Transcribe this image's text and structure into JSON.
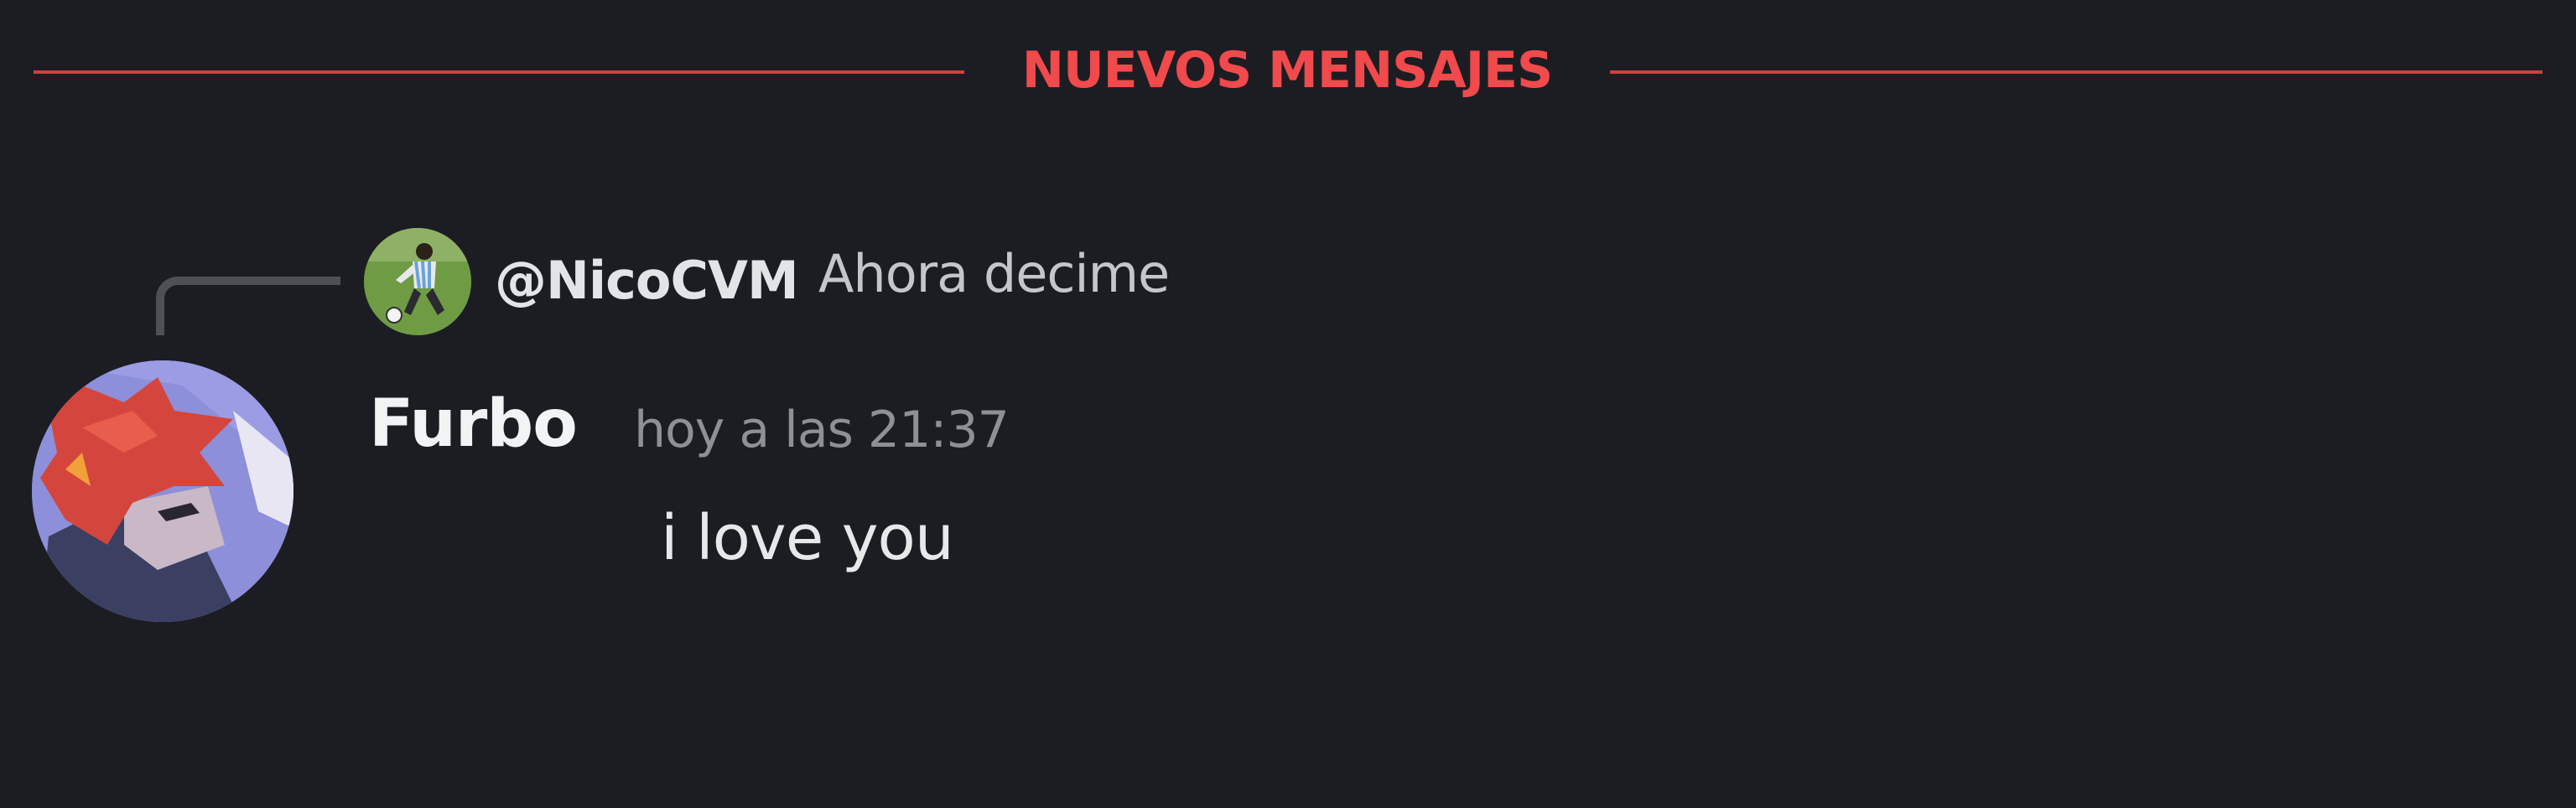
{
  "divider": {
    "label": "NUEVOS MENSAJES"
  },
  "reply": {
    "author": "@NicoCVM",
    "text": "Ahora decime",
    "avatar_icon": "soccer-player-avatar-icon"
  },
  "message": {
    "author": "Furbo",
    "timestamp": "hoy a las 21:37",
    "text": "i love you",
    "avatar_icon": "red-haired-character-avatar-icon"
  },
  "colors": {
    "background": "#1c1d22",
    "new_messages_accent": "#d83c3e",
    "username": "#f2f3f5",
    "timestamp": "#8e9098",
    "reply_spine": "#4f5057"
  }
}
